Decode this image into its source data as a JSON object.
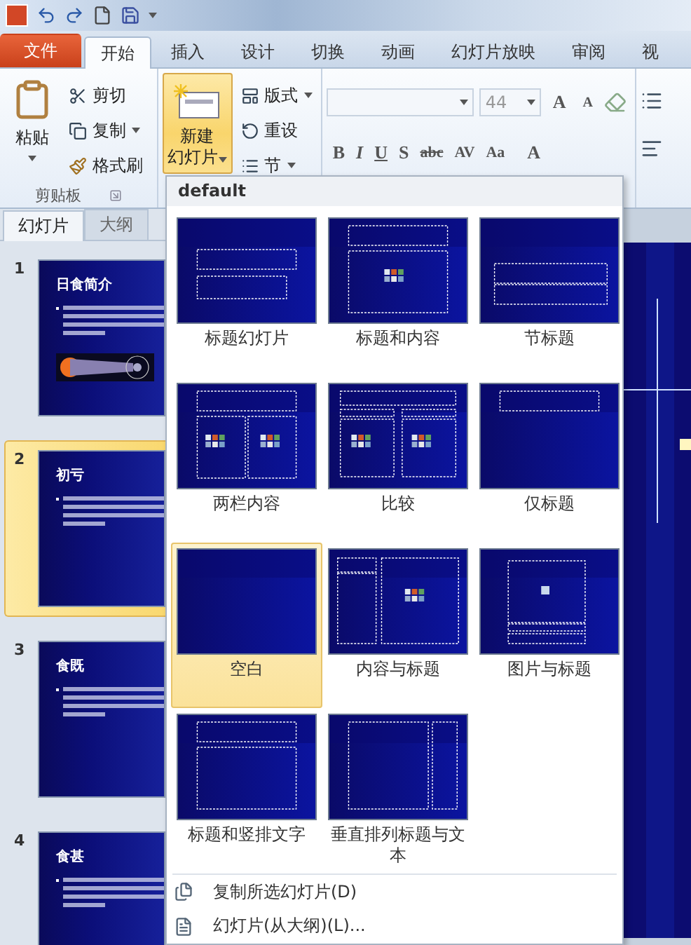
{
  "tabs": [
    {
      "label": "文件",
      "kind": "file",
      "selected": false
    },
    {
      "label": "开始",
      "kind": "tab",
      "selected": true
    },
    {
      "label": "插入",
      "kind": "tab",
      "selected": false
    },
    {
      "label": "设计",
      "kind": "tab",
      "selected": false
    },
    {
      "label": "切换",
      "kind": "tab",
      "selected": false
    },
    {
      "label": "动画",
      "kind": "tab",
      "selected": false
    },
    {
      "label": "幻灯片放映",
      "kind": "tab",
      "selected": false
    },
    {
      "label": "审阅",
      "kind": "tab",
      "selected": false
    },
    {
      "label": "视",
      "kind": "tab",
      "selected": false
    }
  ],
  "ribbon": {
    "clipboard": {
      "paste": "粘贴",
      "cut": "剪切",
      "copy": "复制",
      "format_painter": "格式刷",
      "group_label": "剪贴板"
    },
    "slides": {
      "new_slide_top": "新建",
      "new_slide_bottom": "幻灯片",
      "layout": "版式",
      "reset": "重设",
      "section": "节"
    },
    "font": {
      "size": "44",
      "grow": "A",
      "shrink": "A",
      "format_buttons": [
        "B",
        "I",
        "U",
        "S",
        "abc",
        "AV",
        "Aa"
      ],
      "font_color": "A"
    }
  },
  "slides_panel": {
    "tabs": [
      {
        "label": "幻灯片",
        "selected": true
      },
      {
        "label": "大纲",
        "selected": false
      }
    ],
    "slides": [
      {
        "number": "1",
        "title": "日食简介",
        "selected": false,
        "picture": true
      },
      {
        "number": "2",
        "title": "初亏",
        "selected": true,
        "picture": false
      },
      {
        "number": "3",
        "title": "食既",
        "selected": false,
        "picture": false
      },
      {
        "number": "4",
        "title": "食甚",
        "selected": false,
        "picture": false
      }
    ]
  },
  "layout_menu": {
    "header": "default",
    "layouts": [
      {
        "label": "标题幻灯片",
        "kind": "title",
        "selected": false
      },
      {
        "label": "标题和内容",
        "kind": "title_content",
        "selected": false
      },
      {
        "label": "节标题",
        "kind": "section",
        "selected": false
      },
      {
        "label": "两栏内容",
        "kind": "two_content",
        "selected": false
      },
      {
        "label": "比较",
        "kind": "comparison",
        "selected": false
      },
      {
        "label": "仅标题",
        "kind": "title_only",
        "selected": false
      },
      {
        "label": "空白",
        "kind": "blank",
        "selected": true
      },
      {
        "label": "内容与标题",
        "kind": "content_caption",
        "selected": false
      },
      {
        "label": "图片与标题",
        "kind": "picture_caption",
        "selected": false
      },
      {
        "label": "标题和竖排文字",
        "kind": "vertical_text",
        "selected": false
      },
      {
        "label": "垂直排列标题与文本",
        "kind": "vertical_title",
        "selected": false
      }
    ],
    "commands": [
      {
        "label": "复制所选幻灯片(D)",
        "kind": "duplicate"
      },
      {
        "label": "幻灯片(从大纲)(L)...",
        "kind": "outline"
      }
    ]
  }
}
